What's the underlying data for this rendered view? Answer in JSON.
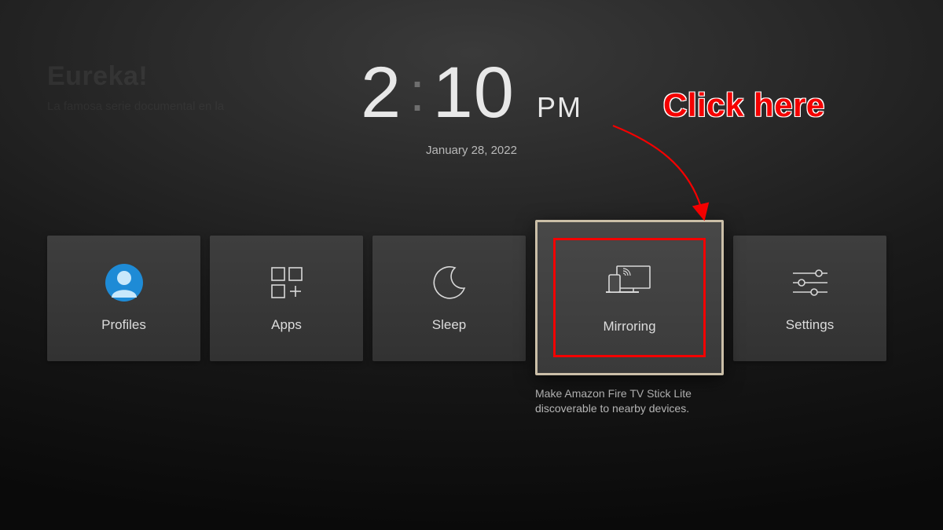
{
  "background": {
    "title": "Eureka!",
    "subtitle": "La famosa serie documental en la"
  },
  "clock": {
    "hour": "2",
    "minute": "10",
    "ampm": "PM",
    "date": "January 28, 2022"
  },
  "tiles": [
    {
      "id": "profiles",
      "label": "Profiles",
      "icon": "profile-icon"
    },
    {
      "id": "apps",
      "label": "Apps",
      "icon": "apps-icon"
    },
    {
      "id": "sleep",
      "label": "Sleep",
      "icon": "moon-icon"
    },
    {
      "id": "mirroring",
      "label": "Mirroring",
      "icon": "mirroring-icon",
      "description": "Make Amazon Fire TV Stick Lite discoverable to nearby devices."
    },
    {
      "id": "settings",
      "label": "Settings",
      "icon": "sliders-icon"
    }
  ],
  "selectedTile": "mirroring",
  "annotation": {
    "text": "Click here"
  }
}
